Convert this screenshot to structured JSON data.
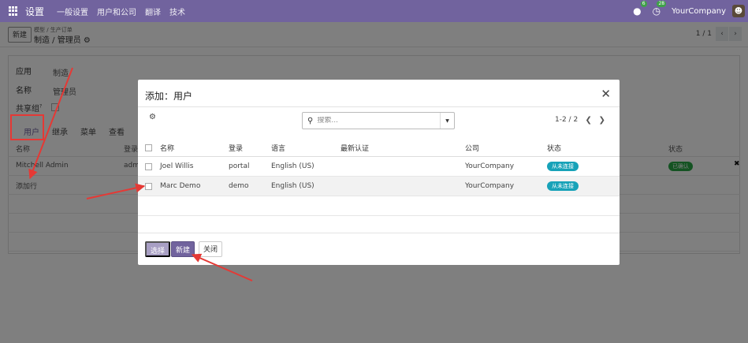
{
  "navbar": {
    "brand": "设置",
    "menu": [
      "一般设置",
      "用户和公司",
      "翻译",
      "技术"
    ],
    "activity_count": "6",
    "discuss_count": "28",
    "company": "YourCompany"
  },
  "control_panel": {
    "new_label": "新建",
    "breadcrumb_parent": "模型 / 生产订单",
    "breadcrumb_current": "制造 / 管理员",
    "pager": "1 / 1"
  },
  "form": {
    "app_label": "应用",
    "app_value": "制造",
    "name_label": "名称",
    "name_value": "管理员",
    "share_label": "共享组",
    "share_tip": "?",
    "tabs": [
      "用户",
      "继承",
      "菜单",
      "查看"
    ],
    "table_head_name": "名称",
    "table_head_login": "登录",
    "table_head_state": "状态",
    "row_name": "Mitchell Admin",
    "row_login": "adm",
    "row_state": "已确认",
    "add_line": "添加行"
  },
  "dialog": {
    "title": "添加：用户",
    "search_placeholder": "搜索...",
    "pager": "1-2 / 2",
    "columns": [
      "名称",
      "登录",
      "语言",
      "最新认证",
      "公司",
      "状态"
    ],
    "rows": [
      {
        "name": "Joel Willis",
        "login": "portal",
        "lang": "English (US)",
        "company": "YourCompany",
        "status": "从未连接"
      },
      {
        "name": "Marc Demo",
        "login": "demo",
        "lang": "English (US)",
        "company": "YourCompany",
        "status": "从未连接"
      }
    ],
    "btn_select": "选择",
    "btn_new": "新建",
    "btn_close": "关闭"
  },
  "colors": {
    "brand": "#71639e",
    "annotation": "#e53935",
    "badge_info": "#17a2b8",
    "badge_success": "#28a745"
  }
}
